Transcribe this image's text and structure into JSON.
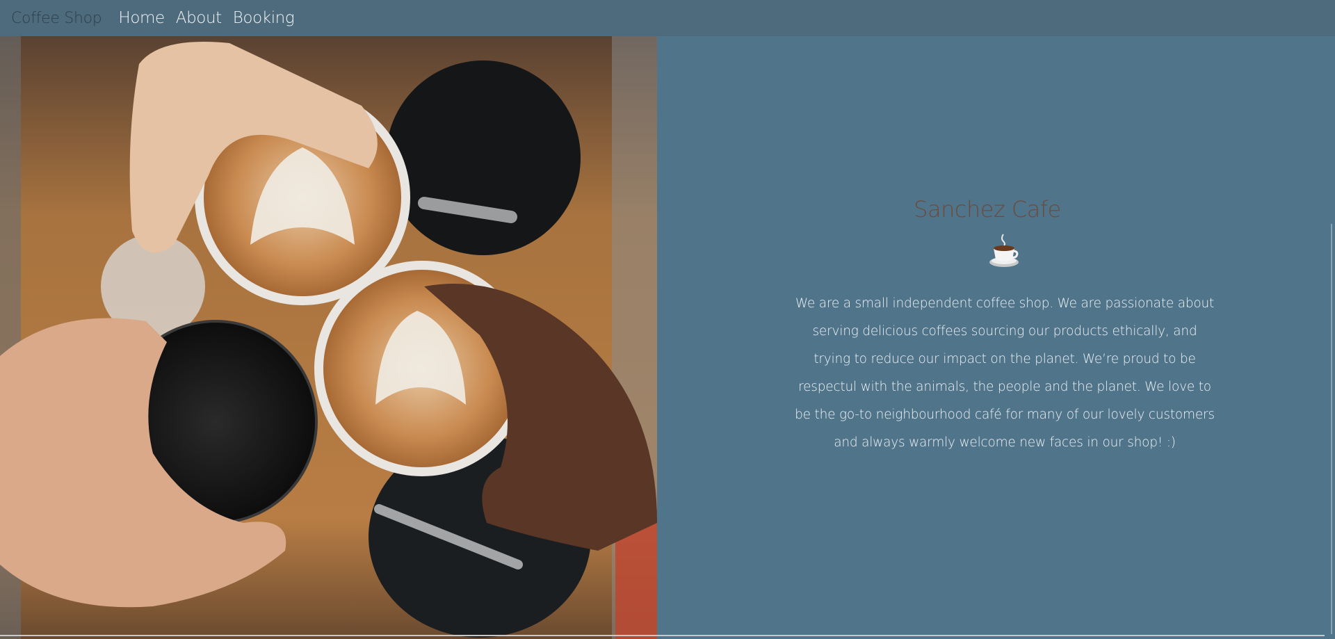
{
  "navbar": {
    "brand": "Coffee Shop",
    "links": [
      "Home",
      "About",
      "Booking"
    ]
  },
  "hero": {
    "image_alt": "coffee-cheers-photo"
  },
  "main": {
    "title": "Sanchez Cafe",
    "icon": "coffee-cup-icon",
    "description": "We are a small independent coffee shop. We are passionate about serving delicious coffees sourcing our products ethically, and trying to reduce our impact on the planet. We’re proud to be respectul with the animals, the people and the planet. We love to be the go-to neighbourhood café for many of our lovely customers and always warmly welcome new faces in our shop! :)"
  },
  "colors": {
    "navbar": "#4e6b7e",
    "background": "#50748a",
    "title": "#6b4b3d",
    "text": "#eef2f5"
  }
}
